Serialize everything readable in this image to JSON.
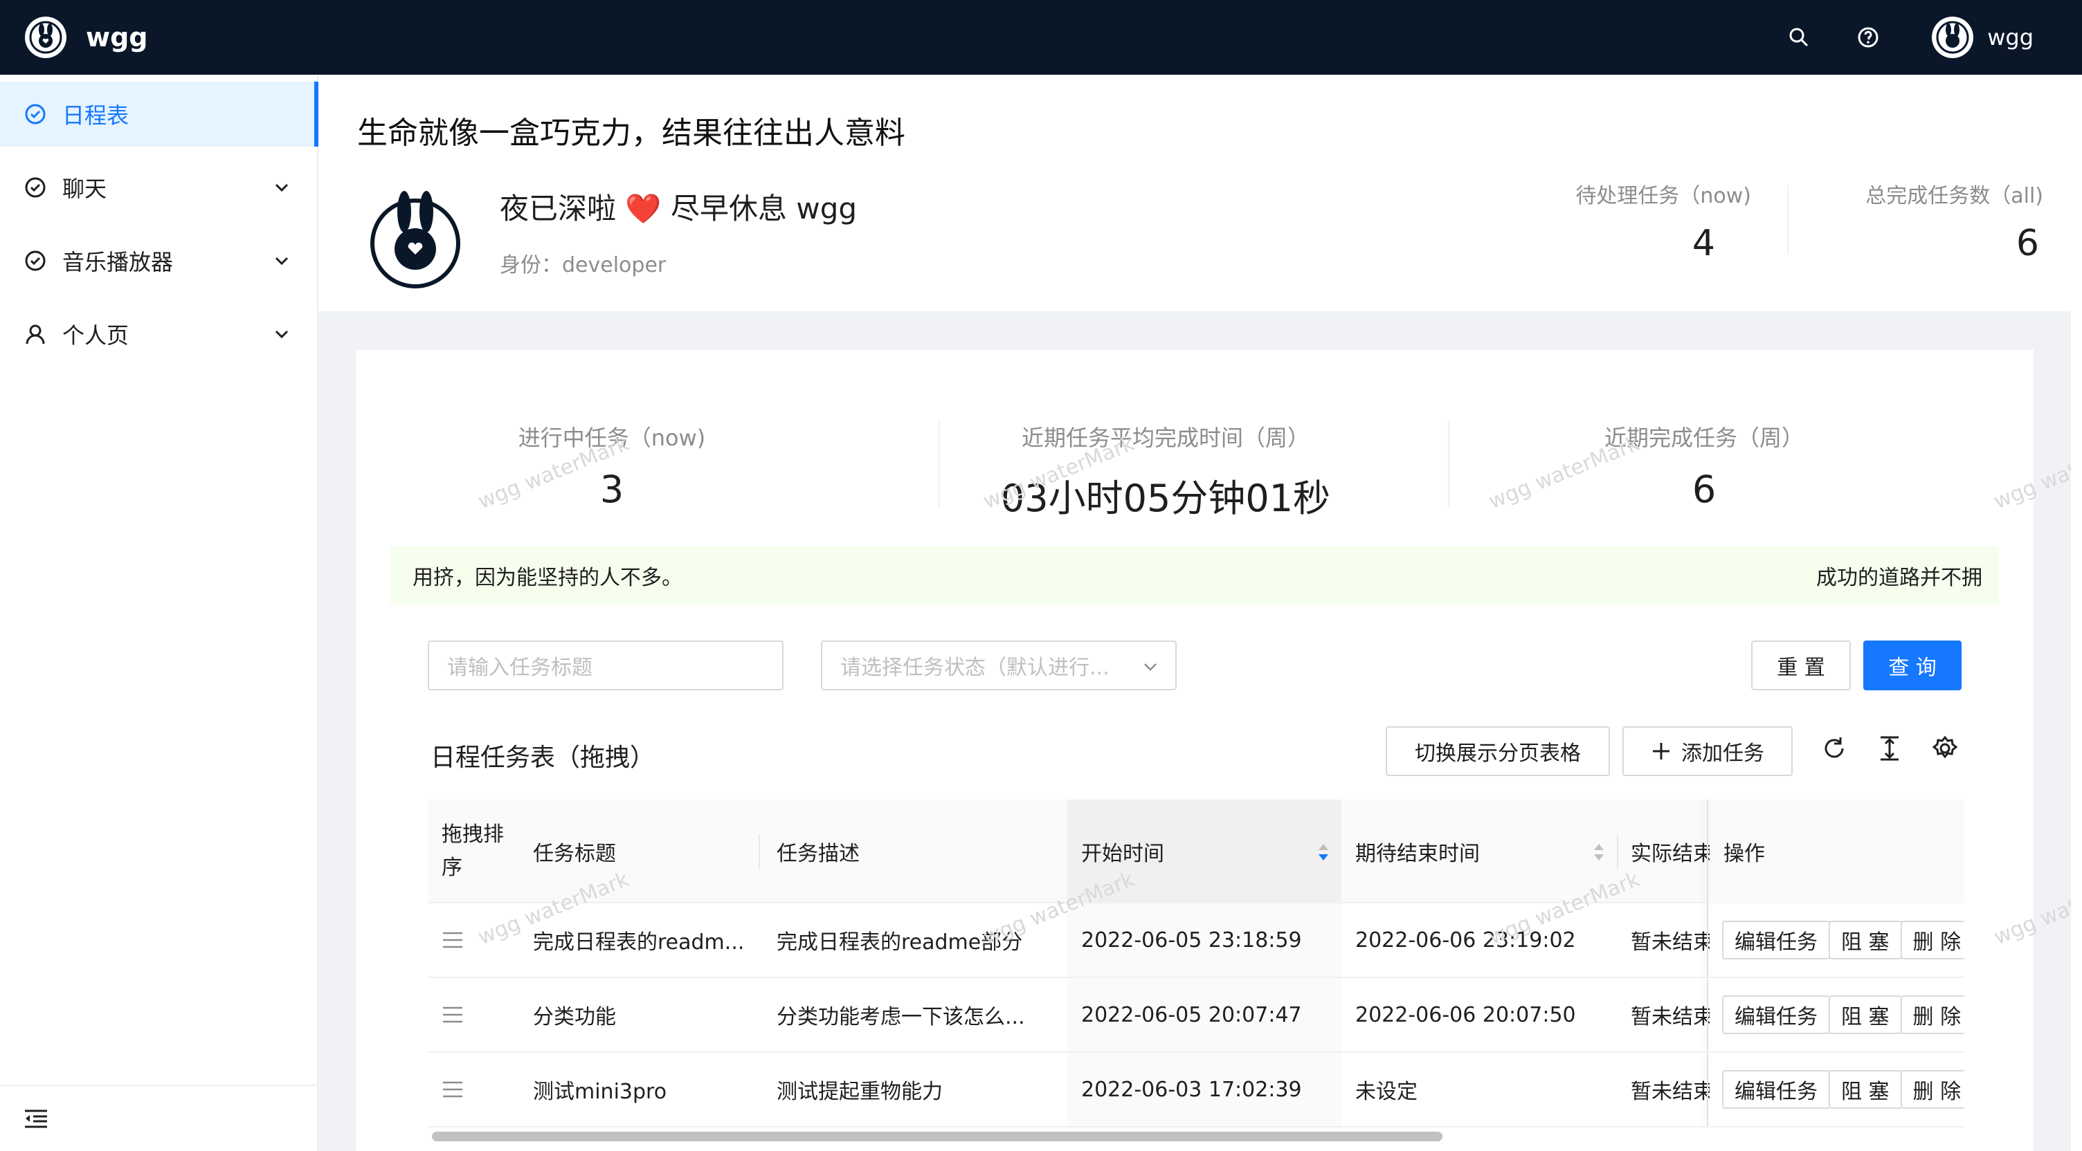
{
  "app": {
    "name": "wgg"
  },
  "header": {
    "user_name": "wgg",
    "icons": [
      "search-icon",
      "question-icon"
    ]
  },
  "sidebar": {
    "items": [
      {
        "label": "日程表",
        "icon": "clock-check-icon",
        "active": true
      },
      {
        "label": "聊天",
        "icon": "check-circle-icon",
        "expandable": true
      },
      {
        "label": "音乐播放器",
        "icon": "check-circle-icon",
        "expandable": true
      },
      {
        "label": "个人页",
        "icon": "user-icon",
        "expandable": true
      }
    ],
    "footer_icon": "menu-fold-icon"
  },
  "page": {
    "slogan": "生命就像一盒巧克力，结果往往出人意料",
    "greeting": "夜已深啦 ❤️ 尽早休息 wgg",
    "identity": "身份：developer",
    "stats": [
      {
        "title": "待处理任务（now)",
        "value": "4"
      },
      {
        "title": "总完成任务数（all)",
        "value": "6"
      }
    ]
  },
  "kpis": [
    {
      "title": "进行中任务（now)",
      "value": "3"
    },
    {
      "title": "近期任务平均完成时间（周）",
      "value": "03小时05分钟01秒"
    },
    {
      "title": "近期完成任务（周）",
      "value": "6"
    }
  ],
  "watermark": {
    "text": "wgg waterMark"
  },
  "alert": {
    "left_text": "用挤，因为能坚持的人不多。",
    "right_text": "成功的道路并不拥"
  },
  "filters": {
    "title_placeholder": "请输入任务标题",
    "status_placeholder": "请选择任务状态（默认进行...",
    "reset_label": "重 置",
    "query_label": "查 询"
  },
  "table": {
    "title": "日程任务表（拖拽）",
    "switch_label": "切换展示分页表格",
    "add_label": "添加任务",
    "columns": [
      "拖拽排序",
      "任务标题",
      "任务描述",
      "开始时间",
      "期待结束时间",
      "实际结束",
      "操作"
    ],
    "rows": [
      {
        "title": "完成日程表的readm...",
        "desc": "完成日程表的readme部分",
        "start": "2022-06-05 23:18:59",
        "expect_end": "2022-06-06 23:19:02",
        "actual_end": "暂未结束"
      },
      {
        "title": "分类功能",
        "desc": "分类功能考虑一下该怎么...",
        "start": "2022-06-05 20:07:47",
        "expect_end": "2022-06-06 20:07:50",
        "actual_end": "暂未结束"
      },
      {
        "title": "测试mini3pro",
        "desc": "测试提起重物能力",
        "start": "2022-06-03 17:02:39",
        "expect_end": "未设定",
        "actual_end": "暂未结束"
      }
    ],
    "ops": {
      "edit": "编辑任务",
      "block": "阻 塞",
      "delete": "删 除"
    }
  },
  "colors": {
    "header_bg": "#0a1729",
    "accent": "#1677ff",
    "alert_bg": "#f6ffed"
  }
}
